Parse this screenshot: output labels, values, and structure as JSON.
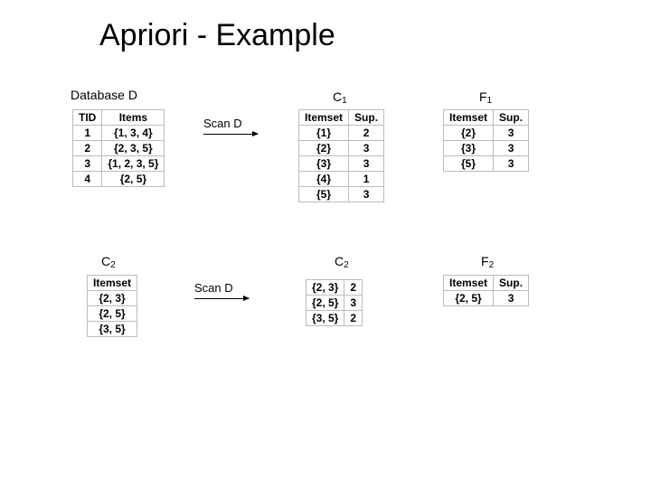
{
  "title": "Apriori - Example",
  "labels": {
    "databaseD": "Database D",
    "C1": "C",
    "C1_sub": "1",
    "F1": "F",
    "F1_sub": "1",
    "C2_left": "C",
    "C2_left_sub": "2",
    "C2_mid": "C",
    "C2_mid_sub": "2",
    "F2": "F",
    "F2_sub": "2",
    "scanD": "Scan D"
  },
  "databaseD": {
    "headers": [
      "TID",
      "Items"
    ],
    "rows": [
      [
        "1",
        "{1, 3, 4}"
      ],
      [
        "2",
        "{2, 3, 5}"
      ],
      [
        "3",
        "{1, 2, 3, 5}"
      ],
      [
        "4",
        "{2, 5}"
      ]
    ]
  },
  "C1": {
    "headers": [
      "Itemset",
      "Sup."
    ],
    "rows": [
      [
        "{1}",
        "2"
      ],
      [
        "{2}",
        "3"
      ],
      [
        "{3}",
        "3"
      ],
      [
        "{4}",
        "1"
      ],
      [
        "{5}",
        "3"
      ]
    ]
  },
  "F1": {
    "headers": [
      "Itemset",
      "Sup."
    ],
    "rows": [
      [
        "{2}",
        "3"
      ],
      [
        "{3}",
        "3"
      ],
      [
        "{5}",
        "3"
      ]
    ]
  },
  "C2_left": {
    "headers": [
      "Itemset"
    ],
    "rows": [
      [
        "{2, 3}"
      ],
      [
        "{2, 5}"
      ],
      [
        "{3, 5}"
      ]
    ]
  },
  "C2_mid": {
    "headers": [
      "",
      ""
    ],
    "rows": [
      [
        "{2, 3}",
        "2"
      ],
      [
        "{2, 5}",
        "3"
      ],
      [
        "{3, 5}",
        "2"
      ]
    ]
  },
  "F2": {
    "headers": [
      "Itemset",
      "Sup."
    ],
    "rows": [
      [
        "{2, 5}",
        "3"
      ]
    ]
  }
}
